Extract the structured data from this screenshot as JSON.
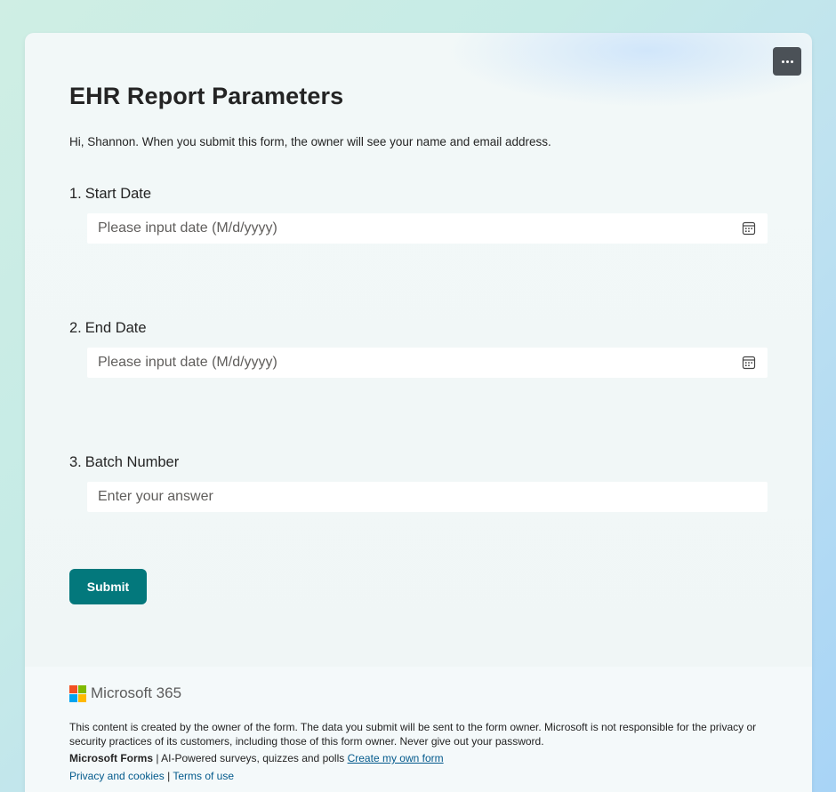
{
  "form": {
    "title": "EHR Report Parameters",
    "greeting": "Hi, Shannon. When you submit this form, the owner will see your name and email address."
  },
  "questions": [
    {
      "number": "1.",
      "label": "Start Date",
      "placeholder": "Please input date (M/d/yyyy)",
      "icon": "calendar-icon"
    },
    {
      "number": "2.",
      "label": "End Date",
      "placeholder": "Please input date (M/d/yyyy)",
      "icon": "calendar-icon"
    },
    {
      "number": "3.",
      "label": "Batch Number",
      "placeholder": "Enter your answer"
    }
  ],
  "submit_label": "Submit",
  "more_options_icon": "ellipsis-icon",
  "footer": {
    "brand": "Microsoft 365",
    "logo_colors": [
      "#f25022",
      "#7fba00",
      "#00a4ef",
      "#ffb900"
    ],
    "disclaimer": "This content is created by the owner of the form. The data you submit will be sent to the form owner. Microsoft is not responsible for the privacy or security practices of its customers, including those of this form owner. Never give out your password.",
    "forms_brand": "Microsoft Forms",
    "forms_tagline": "| AI-Powered surveys, quizzes and polls",
    "create_link": "Create my own form",
    "privacy_link": "Privacy and cookies",
    "separator": "|",
    "terms_link": "Terms of use"
  },
  "colors": {
    "accent": "#03787c",
    "link": "#035a8c"
  }
}
